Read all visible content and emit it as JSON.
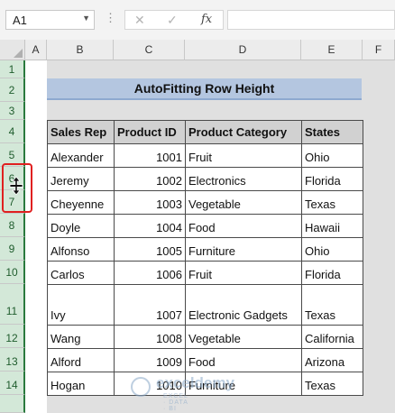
{
  "formula_bar": {
    "name_box": "A1",
    "cancel_icon": "✕",
    "enter_icon": "✓",
    "fx_label": "fx",
    "formula_value": ""
  },
  "columns": [
    "A",
    "B",
    "C",
    "D",
    "E",
    "F"
  ],
  "rows": [
    "1",
    "2",
    "3",
    "4",
    "5",
    "6",
    "7",
    "8",
    "9",
    "10",
    "11",
    "12",
    "13",
    "14"
  ],
  "title": "AutoFitting Row Height",
  "table": {
    "headers": [
      "Sales Rep",
      "Product ID",
      "Product Category",
      "States"
    ],
    "rows": [
      [
        "Alexander",
        "1001",
        "Fruit",
        "Ohio"
      ],
      [
        "Jeremy",
        "1002",
        "Electronics",
        "Florida"
      ],
      [
        "Cheyenne",
        "1003",
        "Vegetable",
        "Texas"
      ],
      [
        "Doyle",
        "1004",
        "Food",
        "Hawaii"
      ],
      [
        "Alfonso",
        "1005",
        "Furniture",
        "Ohio"
      ],
      [
        "Carlos",
        "1006",
        "Fruit",
        "Florida"
      ],
      [
        "Ivy",
        "1007",
        "Electronic Gadgets",
        "Texas"
      ],
      [
        "Wang",
        "1008",
        "Vegetable",
        "California"
      ],
      [
        "Alford",
        "1009",
        "Food",
        "Arizona"
      ],
      [
        "Hogan",
        "1010",
        "Furniture",
        "Texas"
      ]
    ]
  },
  "watermark": {
    "name": "exceldemy",
    "tagline": "EXCEL · DATA · BI"
  },
  "colors": {
    "accent_green": "#2a7a3e",
    "title_fill": "#b4c6e0",
    "header_fill": "#d1d1d1",
    "highlight": "#e02020"
  }
}
